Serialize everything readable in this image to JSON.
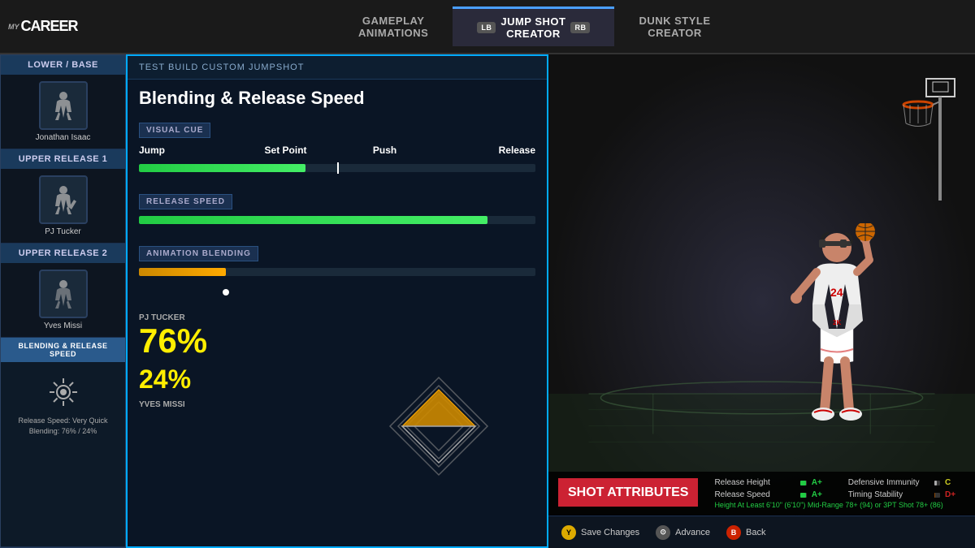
{
  "topNav": {
    "logo": "MyCAREER",
    "tabs": [
      {
        "id": "gameplay",
        "label": "Gameplay\nAnimations",
        "active": false
      },
      {
        "id": "jumpshot",
        "label": "Jump Shot Creator",
        "active": true,
        "lb": "LB",
        "rb": "RB"
      },
      {
        "id": "dunk",
        "label": "Dunk Style\nCreator",
        "active": false
      }
    ]
  },
  "panelTitle": "TEST BUILD CUSTOM JUMPSHOT",
  "leftPanel": {
    "sections": [
      {
        "header": "Lower / Base",
        "players": [
          {
            "name": "Jonathan Isaac",
            "icon": "basketball-player-icon"
          }
        ]
      },
      {
        "header": "Upper Release 1",
        "players": [
          {
            "name": "PJ Tucker",
            "icon": "basketball-player-icon-2"
          }
        ]
      },
      {
        "header": "Upper Release 2",
        "players": [
          {
            "name": "Yves Missi",
            "icon": "basketball-player-icon-3"
          }
        ]
      },
      {
        "header": "Blending & Release Speed",
        "description": "Release Speed: Very Quick\nBlending: 76% / 24%",
        "icon": "gear-icon"
      }
    ]
  },
  "centerPanel": {
    "title": "Blending & Release Speed",
    "visualCue": {
      "label": "VISUAL CUE",
      "cueLabels": {
        "jump": "Jump",
        "setPoint": "Set Point",
        "push": "Push",
        "release": "Release"
      },
      "fillPercent": 42,
      "markerPercent": 50
    },
    "releaseSpeed": {
      "label": "RELEASE SPEED",
      "fillPercent": 88
    },
    "animBlending": {
      "label": "ANIMATION BLENDING",
      "fillPercent": 22,
      "dotPercent": 22
    },
    "player1": {
      "name": "PJ TUCKER",
      "percentage": "76%"
    },
    "player2": {
      "name": "YVES MISSI",
      "percentage": "24%"
    }
  },
  "shotAttributes": {
    "title": "SHOT ATTRIBUTES",
    "attributes": [
      {
        "name": "Release Height",
        "grade": "A+",
        "fill": 92,
        "gradeClass": "green",
        "col": 1
      },
      {
        "name": "Defensive Immunity",
        "grade": "C",
        "fill": 45,
        "gradeClass": "yellow",
        "col": 2
      },
      {
        "name": "Release Speed",
        "grade": "A+",
        "fill": 92,
        "gradeClass": "green",
        "col": 1
      },
      {
        "name": "Timing Stability",
        "grade": "D+",
        "fill": 22,
        "gradeClass": "red",
        "col": 2
      }
    ],
    "footnote": "Height At Least 6'10\" (6'10\")     Mid-Range 78+ (94) or 3PT Shot 78+ (86)"
  },
  "bottomBar": {
    "actions": [
      {
        "button": "Y",
        "label": "Save Changes",
        "btnClass": "btn-y"
      },
      {
        "button": "⊙",
        "label": "Advance",
        "btnClass": "btn-circle"
      },
      {
        "button": "B",
        "label": "Back",
        "btnClass": "btn-b"
      }
    ]
  }
}
